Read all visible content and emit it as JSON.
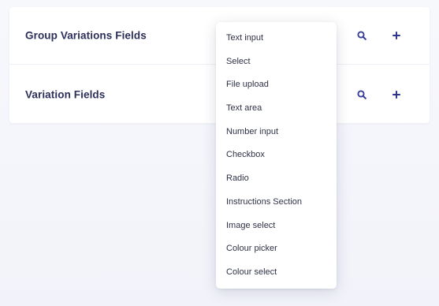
{
  "panel": {
    "rows": [
      {
        "title": "Group Variations Fields"
      },
      {
        "title": "Variation Fields"
      }
    ],
    "icons": {
      "search": "search-icon",
      "add": "plus-icon"
    },
    "accent_color": "#3a3f9a"
  },
  "dropdown": {
    "items": [
      "Text input",
      "Select",
      "File upload",
      "Text area",
      "Number input",
      "Checkbox",
      "Radio",
      "Instructions Section",
      "Image select",
      "Colour picker",
      "Colour select"
    ]
  }
}
